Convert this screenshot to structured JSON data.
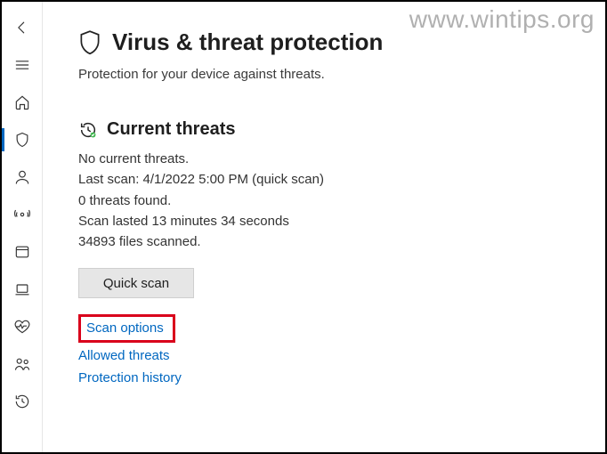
{
  "watermark": "www.wintips.org",
  "header": {
    "title": "Virus & threat protection",
    "subtitle": "Protection for your device against threats."
  },
  "section": {
    "title": "Current threats",
    "lines": {
      "no_threats": "No current threats.",
      "last_scan": "Last scan: 4/1/2022 5:00 PM (quick scan)",
      "threats_found": "0 threats found.",
      "duration": "Scan lasted 13 minutes 34 seconds",
      "files_scanned": "34893 files scanned."
    },
    "quick_scan_label": "Quick scan",
    "links": {
      "scan_options": "Scan options",
      "allowed_threats": "Allowed threats",
      "protection_history": "Protection history"
    }
  }
}
